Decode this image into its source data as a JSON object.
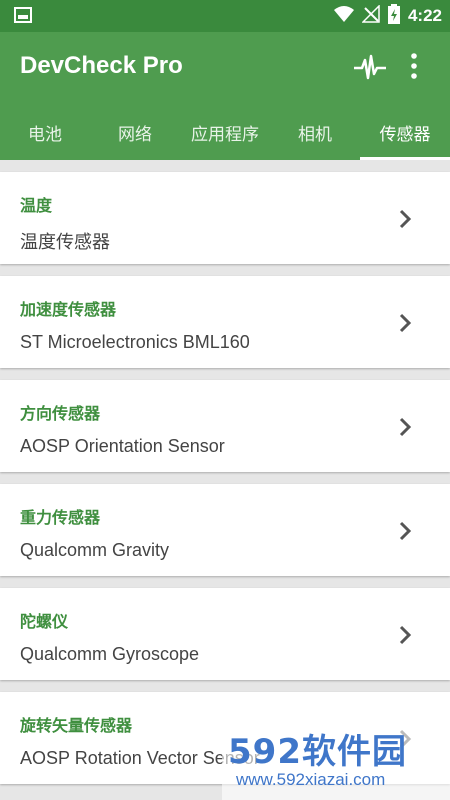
{
  "status_bar": {
    "time": "4:22",
    "icons": [
      "image-icon",
      "wifi-icon",
      "no-signal-icon",
      "battery-charging-icon"
    ]
  },
  "app_bar": {
    "title": "DevCheck Pro",
    "actions": [
      "pulse-icon",
      "more-vert-icon"
    ]
  },
  "tabs": [
    {
      "label": "电池",
      "active": false
    },
    {
      "label": "网络",
      "active": false
    },
    {
      "label": "应用程序",
      "active": false
    },
    {
      "label": "相机",
      "active": false
    },
    {
      "label": "传感器",
      "active": true
    }
  ],
  "sensors": [
    {
      "label": "温度",
      "value": "温度传感器"
    },
    {
      "label": "加速度传感器",
      "value": "ST Microelectronics BML160"
    },
    {
      "label": "方向传感器",
      "value": "AOSP Orientation Sensor"
    },
    {
      "label": "重力传感器",
      "value": "Qualcomm Gravity"
    },
    {
      "label": "陀螺仪",
      "value": "Qualcomm Gyroscope"
    },
    {
      "label": "旋转矢量传感器",
      "value": "AOSP Rotation Vector Sensor"
    }
  ],
  "watermark": {
    "brand": "592软件园",
    "url": "www.592xiazai.com"
  },
  "colors": {
    "status_bar": "#3a8a3d",
    "primary": "#4f9c4f",
    "label_green": "#3f8f3f",
    "background": "#e6e6e6",
    "watermark_blue": "#3f76c9"
  }
}
